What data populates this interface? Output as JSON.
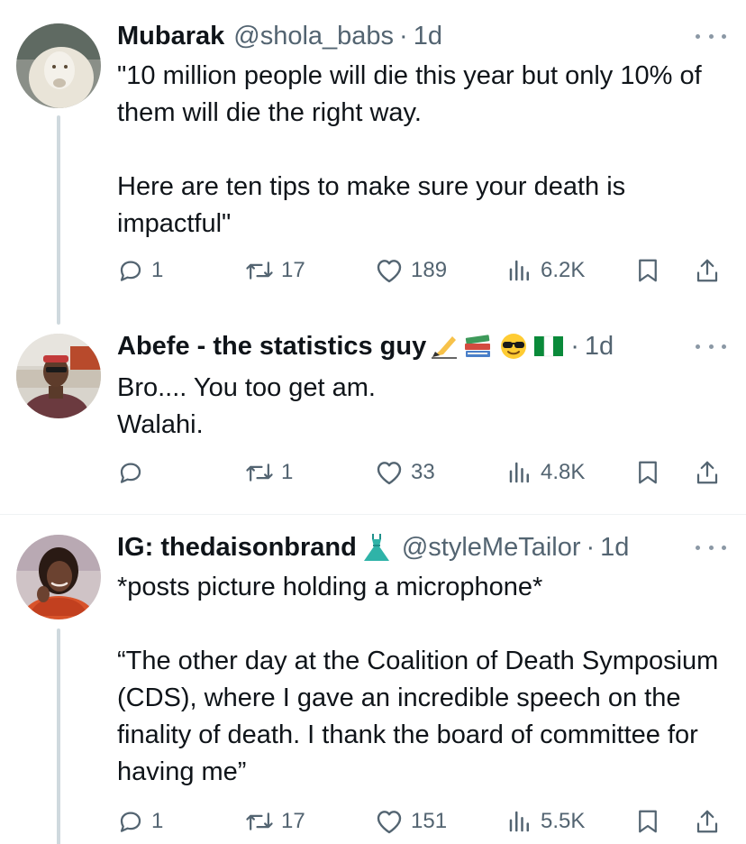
{
  "posts": [
    {
      "name": "Mubarak",
      "handle": "@shola_babs",
      "time": "1d",
      "text": "\"10 million people will die this year but only 10% of them will die the right way.\n\nHere are ten tips to make sure your death is impactful\"",
      "replies": "1",
      "reposts": "17",
      "likes": "189",
      "views": "6.2K"
    },
    {
      "name": "Abefe - the statistics guy",
      "handle": "",
      "time": "1d",
      "text": "Bro.... You too get am.\nWalahi.",
      "replies": "",
      "reposts": "1",
      "likes": "33",
      "views": "4.8K"
    },
    {
      "name": "IG: thedaisonbrand",
      "handle": "@styleMeTailor",
      "time": "1d",
      "text": "*posts picture holding a microphone*\n\n“The other day at the Coalition of Death Symposium (CDS), where I gave an incredible speech on the finality of death. I thank the board of committee for having me”",
      "replies": "1",
      "reposts": "17",
      "likes": "151",
      "views": "5.5K"
    }
  ],
  "separator": "·",
  "icons": {
    "reply": "reply-icon",
    "repost": "repost-icon",
    "like": "heart-icon",
    "views": "views-icon",
    "bookmark": "bookmark-icon",
    "share": "share-icon",
    "more": "more-icon"
  },
  "colors": {
    "text": "#0f1419",
    "secondary": "#536471",
    "thread_line": "#cfd9de"
  }
}
